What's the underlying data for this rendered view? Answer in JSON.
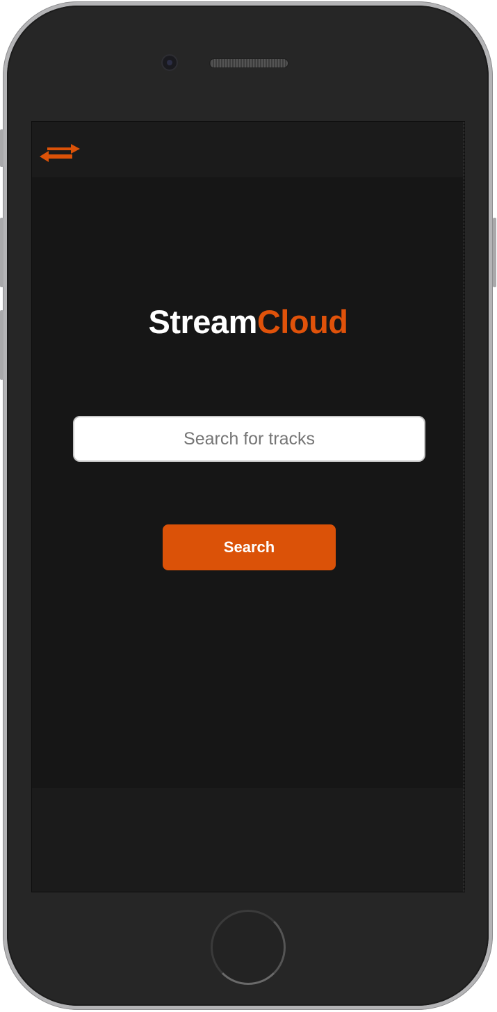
{
  "app": {
    "brand_part1": "Stream",
    "brand_part2": "Cloud"
  },
  "header": {
    "toggle_icon": "swap-arrows-icon"
  },
  "search": {
    "placeholder": "Search for tracks",
    "value": "",
    "button_label": "Search"
  },
  "colors": {
    "accent": "#db5208",
    "brand_text": "#ffffff",
    "background": "#161616",
    "device_frame": "#262626"
  }
}
